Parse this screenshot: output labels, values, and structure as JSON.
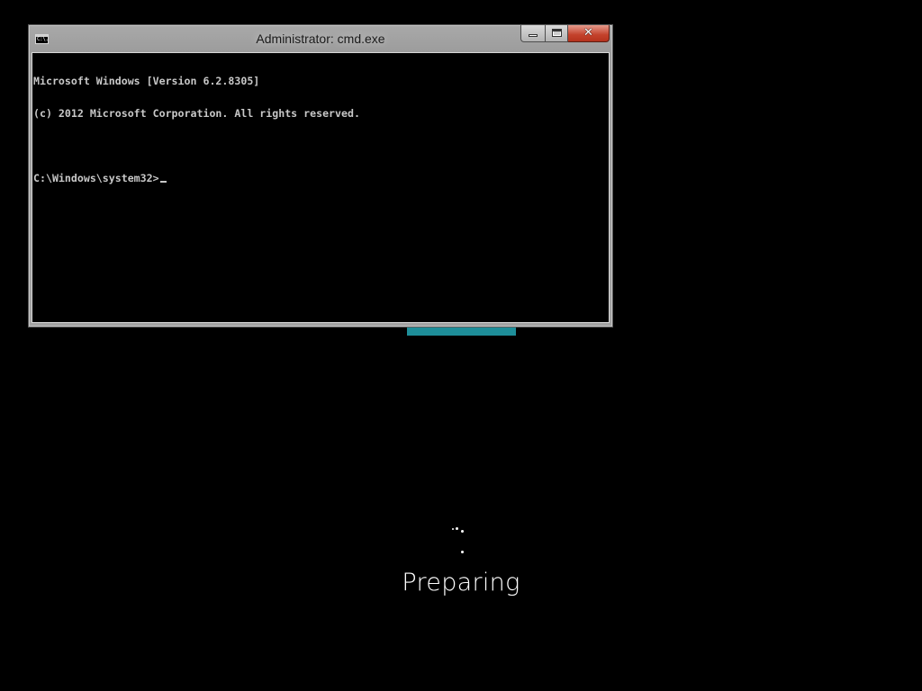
{
  "window": {
    "title": "Administrator: cmd.exe",
    "icon_label": "C:\\.",
    "icon": "cmd-icon",
    "buttons": {
      "minimize": "minimize-icon",
      "maximize": "maximize-icon",
      "close": "close-icon",
      "close_glyph": "✕"
    }
  },
  "console": {
    "lines": [
      "Microsoft Windows [Version 6.2.8305]",
      "(c) 2012 Microsoft Corporation. All rights reserved.",
      "",
      "C:\\Windows\\system32>"
    ],
    "text_color": "#c8c8c8",
    "background": "#000000"
  },
  "status": {
    "label": "Preparing",
    "spinner": "loading-dots-icon"
  },
  "colors": {
    "accent_bar": "#1e8e99",
    "close_button": "#c3412b"
  }
}
